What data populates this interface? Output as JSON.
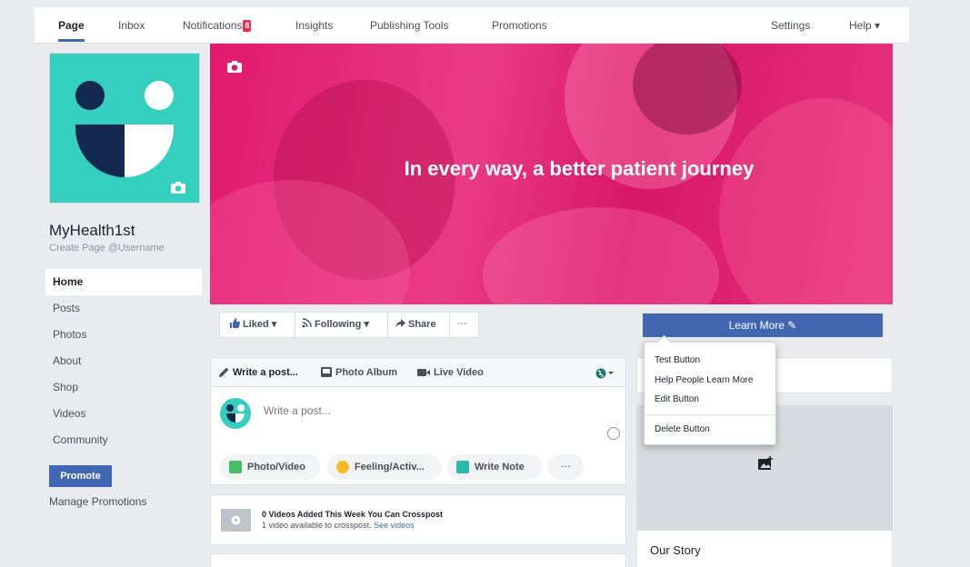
{
  "topnav": {
    "items": [
      {
        "label": "Page",
        "active": true
      },
      {
        "label": "Inbox"
      },
      {
        "label": "Notifications",
        "badge": "8"
      },
      {
        "label": "Insights"
      },
      {
        "label": "Publishing Tools"
      },
      {
        "label": "Promotions"
      }
    ],
    "right_items": [
      {
        "label": "Settings"
      },
      {
        "label": "Help ▾"
      }
    ]
  },
  "page": {
    "name": "MyHealth1st",
    "username_cta": "Create Page @Username",
    "brand_color": "#34cfbe",
    "cover_title": "In every way, a better patient journey",
    "cover_color": "#e0196f"
  },
  "leftnav": {
    "items": [
      {
        "label": "Home",
        "active": true
      },
      {
        "label": "Posts"
      },
      {
        "label": "Photos"
      },
      {
        "label": "About"
      },
      {
        "label": "Shop"
      },
      {
        "label": "Videos"
      },
      {
        "label": "Community"
      }
    ],
    "promote_label": "Promote",
    "manage_promotions_label": "Manage Promotions"
  },
  "actionbar": {
    "liked": "Liked ▾",
    "following": "Following ▾",
    "share": "Share",
    "more": "···",
    "cta_label": "Learn More ✎"
  },
  "cta_dropdown": {
    "items": [
      "Test Button",
      "Help People Learn More",
      "Edit Button",
      "Delete Button"
    ]
  },
  "composer": {
    "tabs": [
      "Write a post...",
      "Photo Album",
      "Live Video"
    ],
    "placeholder": "Write a post...",
    "actions": [
      "Photo/Video",
      "Feeling/Activ...",
      "Write Note",
      "···"
    ]
  },
  "videos_card": {
    "title": "0 Videos Added This Week You Can Crosspost",
    "subtitle": "1 video available to crosspost.",
    "link": "See videos"
  },
  "right": {
    "story_title": "Our Story"
  },
  "colors": {
    "accent": "#4267b2",
    "background": "#e9ebee"
  }
}
